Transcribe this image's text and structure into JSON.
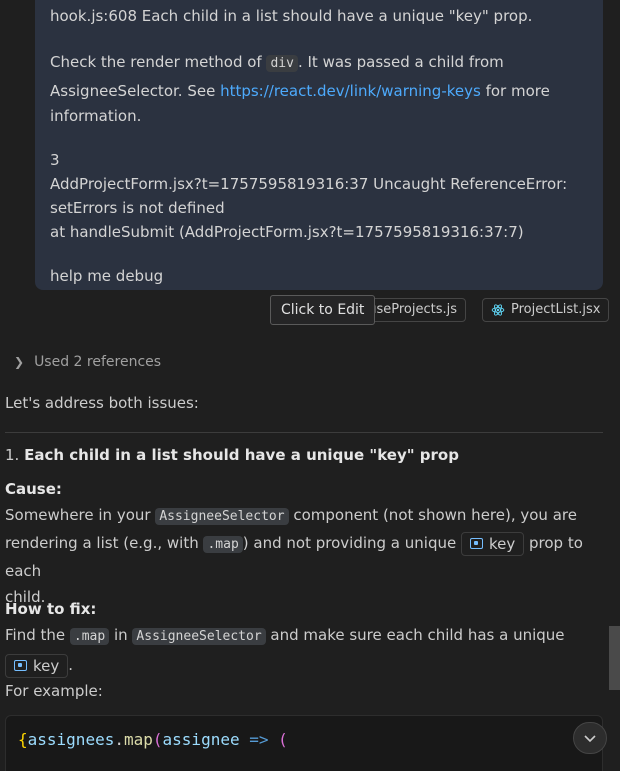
{
  "user_message": {
    "line1": "hook.js:608 Each child in a list should have a unique \"key\" prop.",
    "check_pre": "Check the render method of ",
    "check_code": "div",
    "check_post": ". It was passed a child from",
    "see_pre": "AssigneeSelector. See ",
    "see_link": "https://react.dev/link/warning-keys",
    "see_post": " for more",
    "information": "information.",
    "count": "3",
    "error_line1": "AddProjectForm.jsx?t=1757595819316:37 Uncaught ReferenceError:",
    "error_line2": "setErrors is not defined",
    "error_line3": "at handleSubmit (AddProjectForm.jsx?t=1757595819316:37:7)",
    "request": "help me debug"
  },
  "tooltip": "Click to Edit",
  "attachments": [
    {
      "label": "useProjects.js",
      "icon": "js-icon"
    },
    {
      "label": "ProjectList.jsx",
      "icon": "react-icon"
    }
  ],
  "references": {
    "label": "Used 2 references"
  },
  "response": {
    "intro": "Let's address both issues:",
    "heading_num": "1. ",
    "heading": "Each child in a list should have a unique \"key\" prop",
    "cause_label": "Cause:",
    "cause_pre": "Somewhere in your ",
    "cause_code1": "AssigneeSelector",
    "cause_mid": " component (not shown here), you are",
    "cause_line2_pre": "rendering a list (e.g., with ",
    "cause_code2": ".map",
    "cause_line2_mid": ") and not providing a unique ",
    "key_chip": "key",
    "cause_line2_post": " prop to each",
    "cause_line3": "child.",
    "fix_label": "How to fix:",
    "fix_pre": "Find the ",
    "fix_code1": ".map",
    "fix_mid": " in ",
    "fix_code2": "AssigneeSelector",
    "fix_post": " and make sure each child has a unique",
    "fix_key_chip": "key",
    "fix_dot": ".",
    "example_label": "For example:"
  },
  "code": {
    "brace": "{",
    "var": "assignees",
    "dot": ".",
    "fn": "map",
    "paren": "(",
    "param": "assignee",
    "arrow": " => ",
    "paren2": "("
  }
}
